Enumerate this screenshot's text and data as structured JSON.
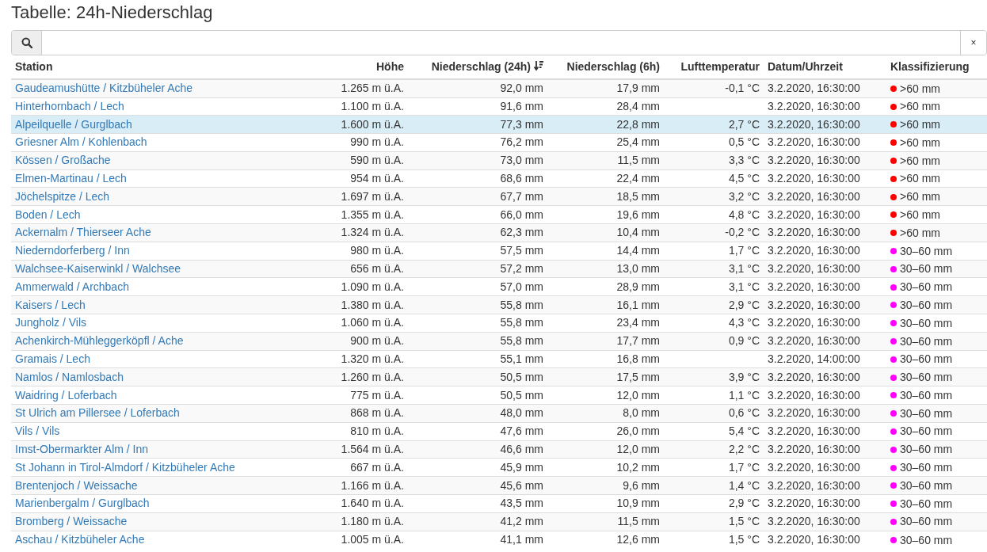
{
  "title": "Tabelle: 24h-Niederschlag",
  "search": {
    "clear_label": "×"
  },
  "columns": [
    {
      "label": "Station",
      "sorted": false
    },
    {
      "label": "Höhe",
      "sorted": false
    },
    {
      "label": "Niederschlag (24h)",
      "sorted": true
    },
    {
      "label": "Niederschlag (6h)",
      "sorted": false
    },
    {
      "label": "Lufttemperatur",
      "sorted": false
    },
    {
      "label": "Datum/Uhrzeit",
      "sorted": false
    },
    {
      "label": "Klassifizierung",
      "sorted": false
    }
  ],
  "rows": [
    {
      "station": "Gaudeamushütte / Kitzbüheler Ache",
      "altitude": "1.265 m ü.A.",
      "precip_24h": "92,0 mm",
      "precip_6h": "17,9 mm",
      "temperature": "-0,1 °C",
      "datetime": "3.2.2020, 16:30:00",
      "class": ">60 mm",
      "color": "#ff0000",
      "selected": false
    },
    {
      "station": "Hinterhornbach / Lech",
      "altitude": "1.100 m ü.A.",
      "precip_24h": "91,6 mm",
      "precip_6h": "28,4 mm",
      "datetime": "3.2.2020, 16:30:00",
      "class": ">60 mm",
      "color": "#ff0000",
      "selected": false
    },
    {
      "station": "Alpeilquelle / Gurglbach",
      "altitude": "1.600 m ü.A.",
      "precip_24h": "77,3 mm",
      "precip_6h": "22,8 mm",
      "temperature": "2,7 °C",
      "datetime": "3.2.2020, 16:30:00",
      "class": ">60 mm",
      "color": "#ff0000",
      "selected": true
    },
    {
      "station": "Griesner Alm / Kohlenbach",
      "altitude": "990 m ü.A.",
      "precip_24h": "76,2 mm",
      "precip_6h": "25,4 mm",
      "temperature": "0,5 °C",
      "datetime": "3.2.2020, 16:30:00",
      "class": ">60 mm",
      "color": "#ff0000",
      "selected": false
    },
    {
      "station": "Kössen / Großache",
      "altitude": "590 m ü.A.",
      "precip_24h": "73,0 mm",
      "precip_6h": "11,5 mm",
      "temperature": "3,3 °C",
      "datetime": "3.2.2020, 16:30:00",
      "class": ">60 mm",
      "color": "#ff0000",
      "selected": false
    },
    {
      "station": "Elmen-Martinau / Lech",
      "altitude": "954 m ü.A.",
      "precip_24h": "68,6 mm",
      "precip_6h": "22,4 mm",
      "temperature": "4,5 °C",
      "datetime": "3.2.2020, 16:30:00",
      "class": ">60 mm",
      "color": "#ff0000",
      "selected": false
    },
    {
      "station": "Jöchelspitze / Lech",
      "altitude": "1.697 m ü.A.",
      "precip_24h": "67,7 mm",
      "precip_6h": "18,5 mm",
      "temperature": "3,2 °C",
      "datetime": "3.2.2020, 16:30:00",
      "class": ">60 mm",
      "color": "#ff0000",
      "selected": false
    },
    {
      "station": "Boden / Lech",
      "altitude": "1.355 m ü.A.",
      "precip_24h": "66,0 mm",
      "precip_6h": "19,6 mm",
      "temperature": "4,8 °C",
      "datetime": "3.2.2020, 16:30:00",
      "class": ">60 mm",
      "color": "#ff0000",
      "selected": false
    },
    {
      "station": "Ackernalm / Thierseer Ache",
      "altitude": "1.324 m ü.A.",
      "precip_24h": "62,3 mm",
      "precip_6h": "10,4 mm",
      "temperature": "-0,2 °C",
      "datetime": "3.2.2020, 16:30:00",
      "class": ">60 mm",
      "color": "#ff0000",
      "selected": false
    },
    {
      "station": "Niederndorferberg / Inn",
      "altitude": "980 m ü.A.",
      "precip_24h": "57,5 mm",
      "precip_6h": "14,4 mm",
      "temperature": "1,7 °C",
      "datetime": "3.2.2020, 16:30:00",
      "class": "30–60 mm",
      "color": "#ff00ff",
      "selected": false
    },
    {
      "station": "Walchsee-Kaiserwinkl / Walchsee",
      "altitude": "656 m ü.A.",
      "precip_24h": "57,2 mm",
      "precip_6h": "13,0 mm",
      "temperature": "3,1 °C",
      "datetime": "3.2.2020, 16:30:00",
      "class": "30–60 mm",
      "color": "#ff00ff",
      "selected": false
    },
    {
      "station": "Ammerwald / Archbach",
      "altitude": "1.090 m ü.A.",
      "precip_24h": "57,0 mm",
      "precip_6h": "28,9 mm",
      "temperature": "3,1 °C",
      "datetime": "3.2.2020, 16:30:00",
      "class": "30–60 mm",
      "color": "#ff00ff",
      "selected": false
    },
    {
      "station": "Kaisers / Lech",
      "altitude": "1.380 m ü.A.",
      "precip_24h": "55,8 mm",
      "precip_6h": "16,1 mm",
      "temperature": "2,9 °C",
      "datetime": "3.2.2020, 16:30:00",
      "class": "30–60 mm",
      "color": "#ff00ff",
      "selected": false
    },
    {
      "station": "Jungholz / Vils",
      "altitude": "1.060 m ü.A.",
      "precip_24h": "55,8 mm",
      "precip_6h": "23,4 mm",
      "temperature": "4,3 °C",
      "datetime": "3.2.2020, 16:30:00",
      "class": "30–60 mm",
      "color": "#ff00ff",
      "selected": false
    },
    {
      "station": "Achenkirch-Mühleggerköpfl / Ache",
      "altitude": "900 m ü.A.",
      "precip_24h": "55,8 mm",
      "precip_6h": "17,7 mm",
      "temperature": "0,9 °C",
      "datetime": "3.2.2020, 16:30:00",
      "class": "30–60 mm",
      "color": "#ff00ff",
      "selected": false
    },
    {
      "station": "Gramais / Lech",
      "altitude": "1.320 m ü.A.",
      "precip_24h": "55,1 mm",
      "precip_6h": "16,8 mm",
      "datetime": "3.2.2020, 14:00:00",
      "class": "30–60 mm",
      "color": "#ff00ff",
      "selected": false
    },
    {
      "station": "Namlos / Namlosbach",
      "altitude": "1.260 m ü.A.",
      "precip_24h": "50,5 mm",
      "precip_6h": "17,5 mm",
      "temperature": "3,9 °C",
      "datetime": "3.2.2020, 16:30:00",
      "class": "30–60 mm",
      "color": "#ff00ff",
      "selected": false
    },
    {
      "station": "Waidring / Loferbach",
      "altitude": "775 m ü.A.",
      "precip_24h": "50,5 mm",
      "precip_6h": "12,0 mm",
      "temperature": "1,1 °C",
      "datetime": "3.2.2020, 16:30:00",
      "class": "30–60 mm",
      "color": "#ff00ff",
      "selected": false
    },
    {
      "station": "St Ulrich am Pillersee / Loferbach",
      "altitude": "868 m ü.A.",
      "precip_24h": "48,0 mm",
      "precip_6h": "8,0 mm",
      "temperature": "0,6 °C",
      "datetime": "3.2.2020, 16:30:00",
      "class": "30–60 mm",
      "color": "#ff00ff",
      "selected": false
    },
    {
      "station": "Vils / Vils",
      "altitude": "810 m ü.A.",
      "precip_24h": "47,6 mm",
      "precip_6h": "26,0 mm",
      "temperature": "5,4 °C",
      "datetime": "3.2.2020, 16:30:00",
      "class": "30–60 mm",
      "color": "#ff00ff",
      "selected": false
    },
    {
      "station": "Imst-Obermarkter Alm / Inn",
      "altitude": "1.564 m ü.A.",
      "precip_24h": "46,6 mm",
      "precip_6h": "12,0 mm",
      "temperature": "2,2 °C",
      "datetime": "3.2.2020, 16:30:00",
      "class": "30–60 mm",
      "color": "#ff00ff",
      "selected": false
    },
    {
      "station": "St Johann in Tirol-Almdorf / Kitzbüheler Ache",
      "altitude": "667 m ü.A.",
      "precip_24h": "45,9 mm",
      "precip_6h": "10,2 mm",
      "temperature": "1,7 °C",
      "datetime": "3.2.2020, 16:30:00",
      "class": "30–60 mm",
      "color": "#ff00ff",
      "selected": false
    },
    {
      "station": "Brentenjoch / Weissache",
      "altitude": "1.166 m ü.A.",
      "precip_24h": "45,6 mm",
      "precip_6h": "9,6 mm",
      "temperature": "1,4 °C",
      "datetime": "3.2.2020, 16:30:00",
      "class": "30–60 mm",
      "color": "#ff00ff",
      "selected": false
    },
    {
      "station": "Marienbergalm / Gurglbach",
      "altitude": "1.640 m ü.A.",
      "precip_24h": "43,5 mm",
      "precip_6h": "10,9 mm",
      "temperature": "2,9 °C",
      "datetime": "3.2.2020, 16:30:00",
      "class": "30–60 mm",
      "color": "#ff00ff",
      "selected": false
    },
    {
      "station": "Bromberg / Weissache",
      "altitude": "1.180 m ü.A.",
      "precip_24h": "41,2 mm",
      "precip_6h": "11,5 mm",
      "temperature": "1,5 °C",
      "datetime": "3.2.2020, 16:30:00",
      "class": "30–60 mm",
      "color": "#ff00ff",
      "selected": false
    },
    {
      "station": "Aschau / Kitzbüheler Ache",
      "altitude": "1.005 m ü.A.",
      "precip_24h": "41,1 mm",
      "precip_6h": "12,6 mm",
      "temperature": "1,5 °C",
      "datetime": "3.2.2020, 16:30:00",
      "class": "30–60 mm",
      "color": "#ff00ff",
      "selected": false
    }
  ]
}
